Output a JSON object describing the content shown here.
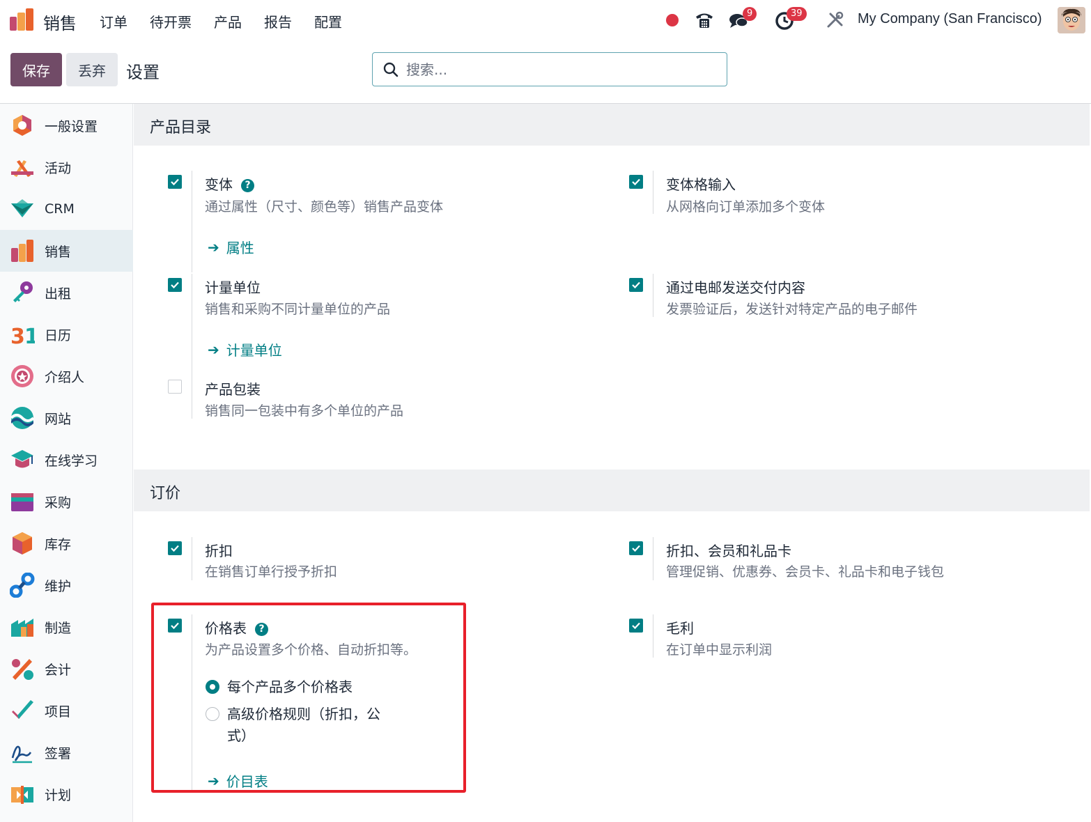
{
  "topnav": {
    "app_name": "销售",
    "menu": [
      "订单",
      "待开票",
      "产品",
      "报告",
      "配置"
    ],
    "chat_badge": "9",
    "activity_badge": "39",
    "company": "My Company (San Francisco)",
    "colors": {
      "brand": "#714b67",
      "accent": "#017e84",
      "badge": "#dc3545"
    }
  },
  "controlbar": {
    "save_label": "保存",
    "discard_label": "丢弃",
    "breadcrumb": "设置",
    "search_placeholder": "搜索..."
  },
  "sidebar": {
    "items": [
      {
        "label": "一般设置",
        "icon": "general-settings-icon"
      },
      {
        "label": "活动",
        "icon": "activity-icon"
      },
      {
        "label": "CRM",
        "icon": "crm-icon"
      },
      {
        "label": "销售",
        "icon": "sales-icon"
      },
      {
        "label": "出租",
        "icon": "rental-icon"
      },
      {
        "label": "日历",
        "icon": "calendar-icon"
      },
      {
        "label": "介绍人",
        "icon": "referral-icon"
      },
      {
        "label": "网站",
        "icon": "website-icon"
      },
      {
        "label": "在线学习",
        "icon": "elearning-icon"
      },
      {
        "label": "采购",
        "icon": "purchase-icon"
      },
      {
        "label": "库存",
        "icon": "inventory-icon"
      },
      {
        "label": "维护",
        "icon": "maintenance-icon"
      },
      {
        "label": "制造",
        "icon": "manufacturing-icon"
      },
      {
        "label": "会计",
        "icon": "accounting-icon"
      },
      {
        "label": "项目",
        "icon": "project-icon"
      },
      {
        "label": "签署",
        "icon": "sign-icon"
      },
      {
        "label": "计划",
        "icon": "planning-icon"
      }
    ],
    "active_index": 3
  },
  "sections": {
    "catalog": {
      "title": "产品目录",
      "variants": {
        "title": "变体",
        "desc": "通过属性（尺寸、颜色等）销售产品变体",
        "link": "属性",
        "checked": true
      },
      "grid_entry": {
        "title": "变体格输入",
        "desc": "从网格向订单添加多个变体",
        "checked": true
      },
      "uom": {
        "title": "计量单位",
        "desc": "销售和采购不同计量单位的产品",
        "link": "计量单位",
        "checked": true
      },
      "email_delivery": {
        "title": "通过电邮发送交付内容",
        "desc": "发票验证后，发送针对特定产品的电子邮件",
        "checked": true
      },
      "packaging": {
        "title": "产品包装",
        "desc": "销售同一包装中有多个单位的产品",
        "checked": false
      }
    },
    "pricing": {
      "title": "订价",
      "discounts": {
        "title": "折扣",
        "desc": "在销售订单行授予折扣",
        "checked": true
      },
      "loyalty": {
        "title": "折扣、会员和礼品卡",
        "desc": "管理促销、优惠券、会员卡、礼品卡和电子钱包",
        "checked": true
      },
      "pricelists": {
        "title": "价格表",
        "desc": "为产品设置多个价格、自动折扣等。",
        "option1": "每个产品多个价格表",
        "option2_line1": "高级价格规则（折扣，公",
        "option2_line2": "式）",
        "selected_option": 1,
        "link": "价目表",
        "checked": true
      },
      "margins": {
        "title": "毛利",
        "desc": "在订单中显示利润",
        "checked": true
      }
    }
  }
}
